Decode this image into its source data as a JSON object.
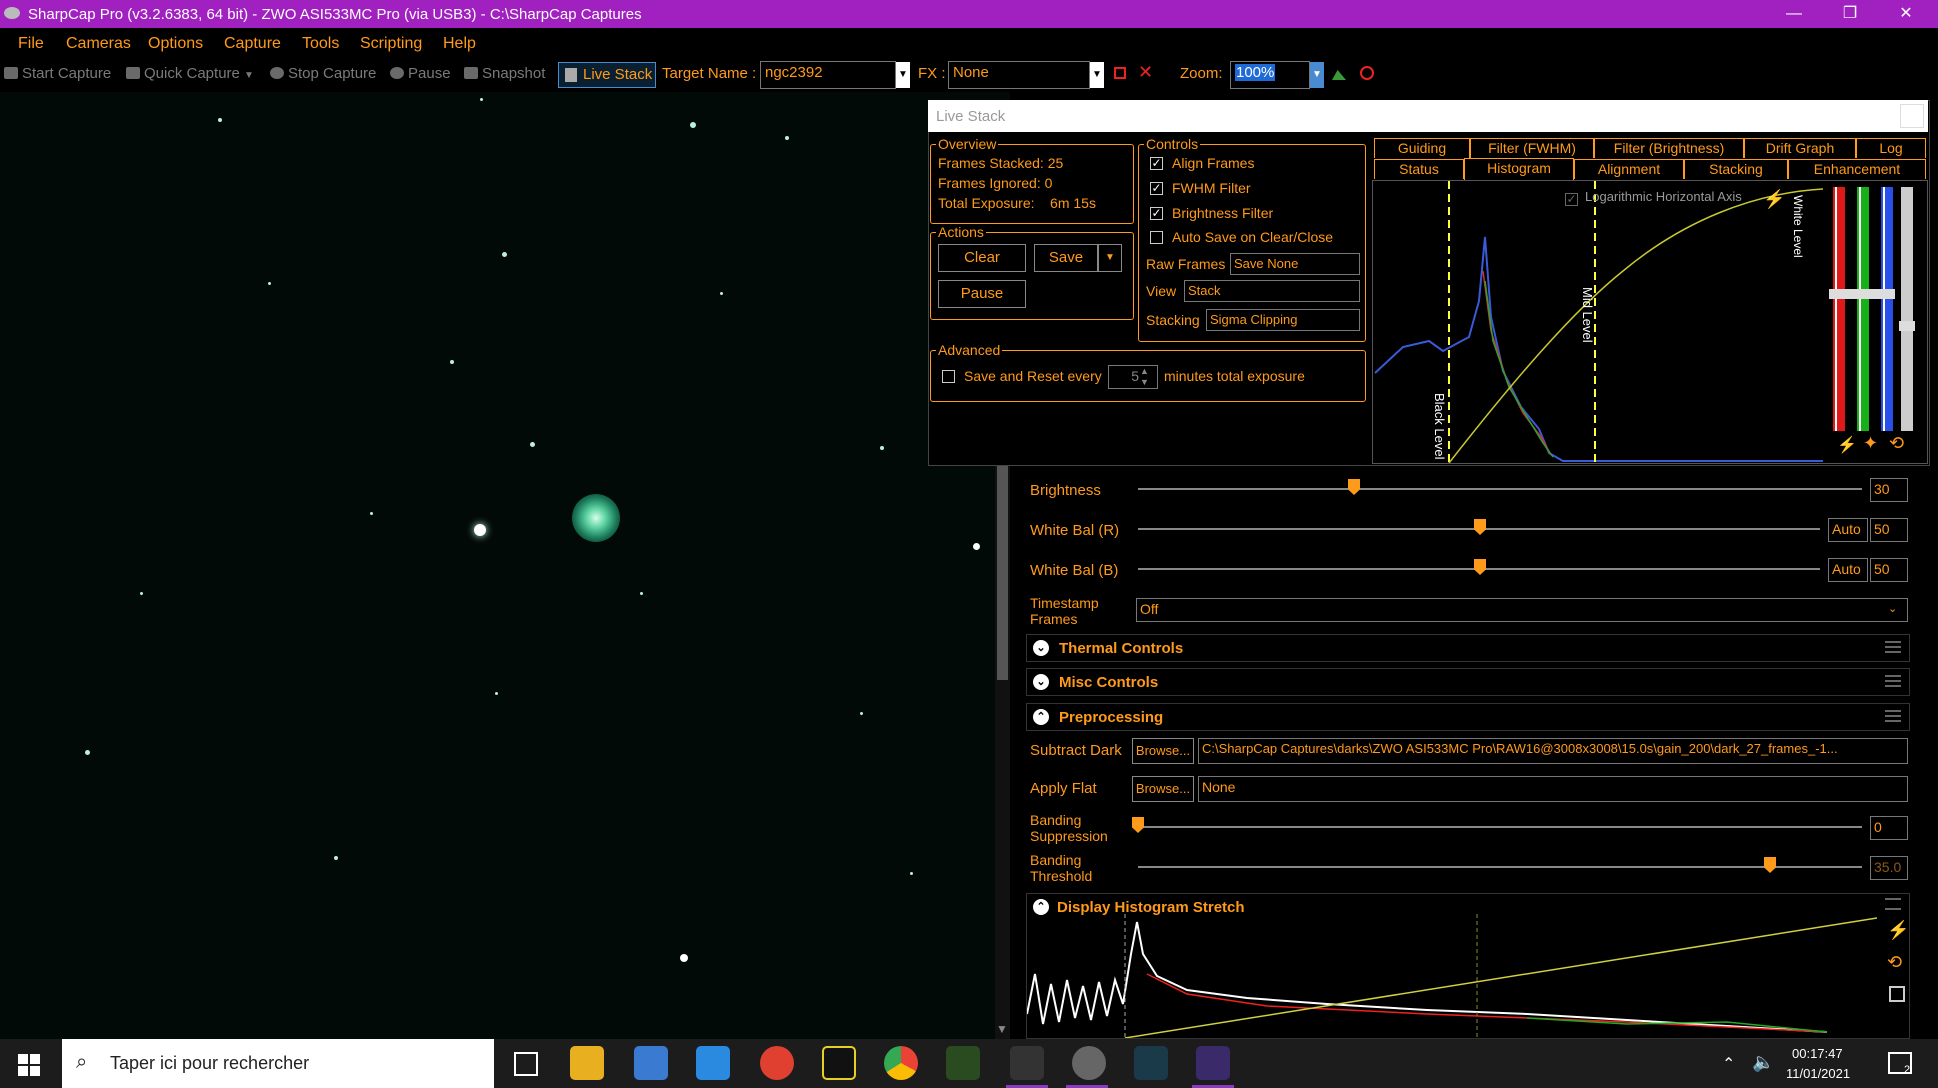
{
  "window": {
    "title": "SharpCap Pro (v3.2.6383, 64 bit) - ZWO ASI533MC Pro (via USB3) - C:\\SharpCap Captures",
    "minimize": "—",
    "maximize": "❐",
    "close": "✕"
  },
  "menu": [
    "File",
    "Cameras",
    "Options",
    "Capture",
    "Tools",
    "Scripting",
    "Help"
  ],
  "toolbar": {
    "start_capture": "Start Capture",
    "quick_capture": "Quick Capture",
    "stop_capture": "Stop Capture",
    "pause": "Pause",
    "snapshot": "Snapshot",
    "live_stack": "Live Stack",
    "target_name_label": "Target Name :",
    "target_name_value": "ngc2392",
    "fx_label": "FX :",
    "fx_value": "None",
    "zoom_label": "Zoom:",
    "zoom_value": "100%"
  },
  "live_stack": {
    "title": "Live Stack",
    "overview": {
      "title": "Overview",
      "frames_stacked": "Frames Stacked:  25",
      "frames_ignored": "Frames Ignored:  0",
      "total_exposure": "Total Exposure:    6m 15s"
    },
    "actions": {
      "title": "Actions",
      "clear": "Clear",
      "save": "Save",
      "pause": "Pause"
    },
    "advanced": {
      "title": "Advanced",
      "save_reset_label": "Save and Reset every",
      "save_reset_value": "5",
      "save_reset_suffix": "minutes total exposure",
      "save_reset_checked": false
    },
    "controls": {
      "title": "Controls",
      "align_frames": "Align Frames",
      "fwhm_filter": "FWHM Filter",
      "brightness_filter": "Brightness Filter",
      "auto_save": "Auto Save on Clear/Close",
      "raw_frames_label": "Raw Frames",
      "raw_frames_value": "Save None",
      "view_label": "View",
      "view_value": "Stack",
      "stacking_label": "Stacking",
      "stacking_value": "Sigma Clipping"
    },
    "tabs_row1": [
      "Guiding",
      "Filter (FWHM)",
      "Filter (Brightness)",
      "Drift Graph",
      "Log"
    ],
    "tabs_row2": [
      "Status",
      "Histogram",
      "Alignment",
      "Stacking",
      "Enhancement"
    ],
    "histogram": {
      "log_axis_label": "Logarithmic Horizontal Axis",
      "black_level": "Black Level",
      "mid_level": "Mid Level",
      "white_level": "White Level"
    }
  },
  "camera_controls": {
    "brightness_label": "Brightness",
    "brightness_value": "30",
    "brightness_level": 0.3,
    "wb_r_label": "White Bal (R)",
    "wb_r_value": "50",
    "wb_b_label": "White Bal (B)",
    "wb_b_value": "50",
    "auto": "Auto",
    "timestamp_label": "Timestamp Frames",
    "timestamp_value": "Off",
    "thermal": "Thermal Controls",
    "misc": "Misc Controls",
    "preprocessing": "Preprocessing",
    "subtract_dark_label": "Subtract Dark",
    "browse": "Browse...",
    "subtract_dark_value": "C:\\SharpCap Captures\\darks\\ZWO ASI533MC Pro\\RAW16@3008x3008\\15.0s\\gain_200\\dark_27_frames_-1...",
    "apply_flat_label": "Apply Flat",
    "apply_flat_value": "None",
    "banding_supp_label": "Banding Suppression",
    "banding_supp_value": "0",
    "banding_thresh_label": "Banding Threshold",
    "banding_thresh_value": "35.0",
    "display_stretch": "Display Histogram Stretch"
  },
  "taskbar": {
    "search_placeholder": "Taper ici pour rechercher",
    "time": "00:17:47",
    "date": "11/01/2021",
    "notifications": "2"
  },
  "colors": {
    "accent": "#ff9a1a",
    "titlebar": "#a020c0"
  }
}
